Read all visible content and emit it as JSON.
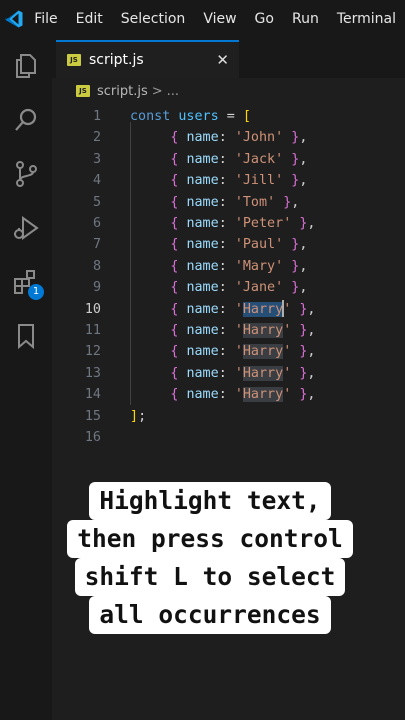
{
  "menubar": {
    "logo_icon": "vscode-logo-icon",
    "items": [
      "File",
      "Edit",
      "Selection",
      "View",
      "Go",
      "Run",
      "Terminal"
    ]
  },
  "activitybar": {
    "icons": [
      "files-explorer-icon",
      "search-icon",
      "source-control-icon",
      "run-debug-icon",
      "extensions-icon",
      "bookmarks-icon"
    ],
    "extensions_badge": "1"
  },
  "tab": {
    "file_icon": "js-file-icon",
    "label": "script.js",
    "close": "✕"
  },
  "breadcrumb": {
    "label": "script.js",
    "separator": ">",
    "trailing": "..."
  },
  "editor": {
    "active_line": 10,
    "lines": [
      {
        "n": "1",
        "text": "const users = ["
      },
      {
        "n": "2",
        "text": "{ name: 'John' },"
      },
      {
        "n": "3",
        "text": "{ name: 'Jack' },"
      },
      {
        "n": "4",
        "text": "{ name: 'Jill' },"
      },
      {
        "n": "5",
        "text": "{ name: 'Tom' },"
      },
      {
        "n": "6",
        "text": "{ name: 'Peter' },"
      },
      {
        "n": "7",
        "text": "{ name: 'Paul' },"
      },
      {
        "n": "8",
        "text": "{ name: 'Mary' },"
      },
      {
        "n": "9",
        "text": "{ name: 'Jane' },"
      },
      {
        "n": "10",
        "text": "{ name: 'Harry' },"
      },
      {
        "n": "11",
        "text": "{ name: 'Harry' },"
      },
      {
        "n": "12",
        "text": "{ name: 'Harry' },"
      },
      {
        "n": "13",
        "text": "{ name: 'Harry' },"
      },
      {
        "n": "14",
        "text": "{ name: 'Harry' },"
      },
      {
        "n": "15",
        "text": "];"
      },
      {
        "n": "16",
        "text": ""
      }
    ],
    "tokens": {
      "const": "const",
      "users": "users",
      "eq": "=",
      "open": "[",
      "close": "];",
      "lbrace": "{",
      "rbrace": "}",
      "name_key": "name",
      "colon": ":",
      "comma": ",",
      "quote": "'"
    },
    "names": [
      "John",
      "Jack",
      "Jill",
      "Tom",
      "Peter",
      "Paul",
      "Mary",
      "Jane",
      "Harry",
      "Harry",
      "Harry",
      "Harry",
      "Harry"
    ],
    "selected_word": "Harry"
  },
  "caption": {
    "lines": [
      "Highlight text,",
      "then press control",
      "shift L to select",
      "all occurrences"
    ]
  }
}
